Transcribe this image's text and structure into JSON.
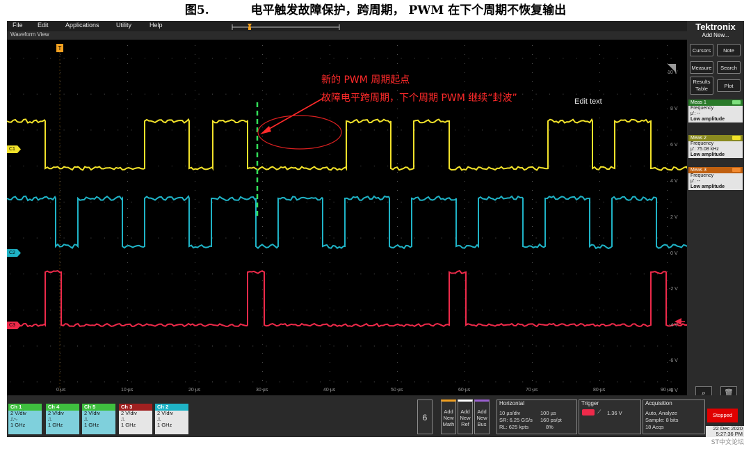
{
  "figure": {
    "number": "图5.",
    "title": "电平触发故障保护，跨周期， PWM 在下个周期不恢复输出"
  },
  "menubar": {
    "items": [
      "File",
      "Edit",
      "Applications",
      "Utility",
      "Help"
    ]
  },
  "waveform_view": {
    "title": "Waveform View",
    "edit_text": "Edit text"
  },
  "annotation": {
    "line1": "新的 PWM 周期起点",
    "line2": "故障电平跨周期，下个周期 PWM 继续“封波”",
    "color": "#ff2a2a"
  },
  "right_panel": {
    "brand": "Tektronix",
    "add_new": "Add New...",
    "buttons": {
      "cursors": "Cursors",
      "note": "Note",
      "measure": "Measure",
      "search": "Search",
      "results_table": "Results Table",
      "plot": "Plot"
    },
    "meas": [
      {
        "title": "Meas 1",
        "name": "Frequency",
        "mu": "µ': --",
        "status": "Low amplitude",
        "color": "#2a7a2a"
      },
      {
        "title": "Meas 2",
        "name": "Frequency",
        "mu": "µ': 75.08 kHz",
        "status": "Low amplitude",
        "color": "#8a8a20"
      },
      {
        "title": "Meas 3",
        "name": "Frequency",
        "mu": "µ': --",
        "status": "Low amplitude",
        "color": "#c06010"
      }
    ],
    "icons": [
      "zoom-icon",
      "trash-icon"
    ]
  },
  "axis": {
    "volt_labels": [
      "10 V",
      "8 V",
      "6 V",
      "4 V",
      "2 V",
      "0 V",
      "-2 V",
      "-4 V",
      "-6 V",
      "-8 V"
    ],
    "time_labels": [
      "0 µs",
      "10 µs",
      "20 µs",
      "30 µs",
      "40 µs",
      "50 µs",
      "60 µs",
      "70 µs",
      "80 µs",
      "90 µs"
    ]
  },
  "channels": {
    "tags": [
      "C1",
      "C2",
      "C3"
    ],
    "colors": {
      "c1": "#f2e22a",
      "c2": "#1fb3c6",
      "c3": "#ee2a4a"
    }
  },
  "bottom": {
    "badges": [
      {
        "title": "Ch 1",
        "line1": "2 V/div",
        "line2": "",
        "line3": "1 GHz",
        "color": "#3fbf3f"
      },
      {
        "title": "Ch 4",
        "line1": "2 V/div",
        "line2": "",
        "line3": "1 GHz",
        "color": "#3fbf3f"
      },
      {
        "title": "Ch 5",
        "line1": "2 V/div",
        "line2": "",
        "line3": "1 GHz",
        "color": "#3fbf3f"
      },
      {
        "title": "Ch 3",
        "line1": "2 V/div",
        "line2": "",
        "line3": "1 GHz",
        "color": "#a02020"
      },
      {
        "title": "Ch 2",
        "line1": "2 V/div",
        "line2": "",
        "line3": "1 GHz",
        "color": "#1fb3c6"
      }
    ],
    "six": "6",
    "add_math": "Add New Math",
    "add_ref": "Add New Ref",
    "add_bus": "Add New Bus",
    "horizontal": {
      "title": "Horizontal",
      "l1a": "10 µs/div",
      "l1b": "100 µs",
      "l2a": "SR: 6.25 GS/s",
      "l2b": "160 ps/pt",
      "l3a": "RL: 625 kpts",
      "l3b": "8%"
    },
    "trigger": {
      "title": "Trigger",
      "value": "1.36 V"
    },
    "acquisition": {
      "title": "Acquisition",
      "l1": "Auto,   Analyze",
      "l2": "Sample: 8 bits",
      "l3": "18 Acqs"
    },
    "stopped": "Stopped",
    "date": "22 Dec 2020",
    "time": "5:27:36 PM"
  },
  "watermark": "ST中文论坛"
}
